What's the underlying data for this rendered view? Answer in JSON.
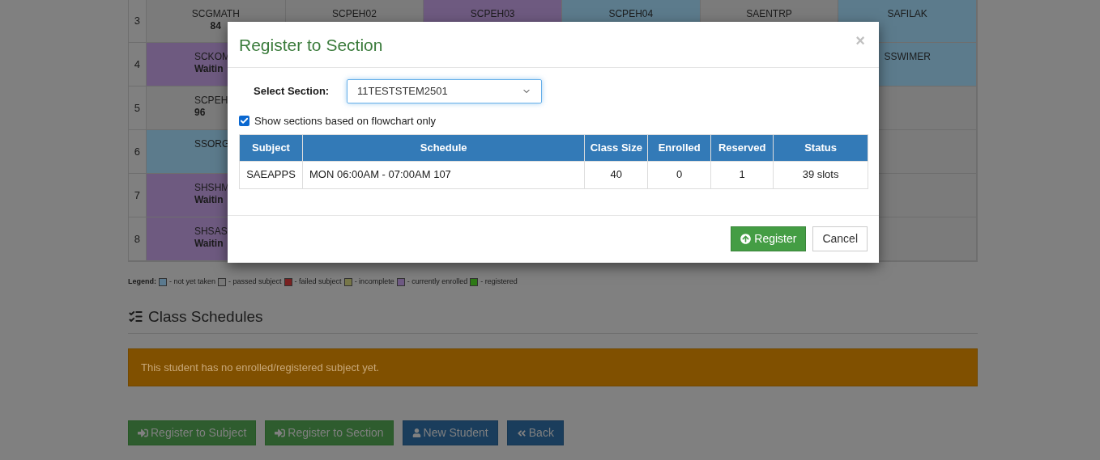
{
  "grid": {
    "rows": [
      {
        "number": "3",
        "cells": [
          {
            "code": "SCGMATH",
            "note": "84",
            "color": "#7b7b7b"
          },
          {
            "code": "SCPEH02",
            "color": "#7b7b7b"
          },
          {
            "code": "SCPEH03",
            "color": "#6e5a80"
          },
          {
            "code": "SCPEH04",
            "color": "#5c7b8c"
          },
          {
            "code": "SAENTRP",
            "color": "#7b7b7b"
          },
          {
            "code": "SAFILAK",
            "color": "#5c7b8c"
          }
        ]
      },
      {
        "number": "4",
        "cells": [
          {
            "code": "SCKOM",
            "note": "Waitin",
            "color": "#6e5a80"
          },
          null,
          null,
          null,
          null,
          {
            "code": "SSWIMER",
            "color": "#5c7b8c"
          }
        ]
      },
      {
        "number": "5",
        "cells": [
          {
            "code": "SCPEH",
            "note": "96",
            "color": "#7b7b7b"
          },
          null,
          null,
          null,
          null,
          {
            "color": "#7b7b7b"
          }
        ]
      },
      {
        "number": "6",
        "cells": [
          {
            "code": "SSORG",
            "color": "#5c7b8c"
          },
          null,
          null,
          null,
          null,
          {
            "color": "#7b7b7b"
          }
        ]
      },
      {
        "number": "7",
        "cells": [
          {
            "code": "SHSHM",
            "note": "Waitin",
            "color": "#6e5a80"
          },
          null,
          null,
          null,
          null,
          {
            "color": "#7b7b7b"
          }
        ]
      },
      {
        "number": "8",
        "cells": [
          {
            "code": "SHSAS",
            "note": "Waitin",
            "color": "#6e5a80"
          },
          null,
          null,
          null,
          null,
          {
            "color": "#7b7b7b"
          }
        ]
      }
    ]
  },
  "legend": {
    "label": "Legend:",
    "items": [
      {
        "label": "- not yet taken",
        "color": "#5b7a8f"
      },
      {
        "label": "- passed subject",
        "color": "#797979"
      },
      {
        "label": "- failed subject",
        "color": "#7a2222"
      },
      {
        "label": "- incomplete",
        "color": "#78784a"
      },
      {
        "label": "- currently enrolled",
        "color": "#6f5a84"
      },
      {
        "label": "- registered",
        "color": "#2e7a16"
      }
    ]
  },
  "class_schedules": {
    "title": "Class Schedules",
    "alert": "This student has no enrolled/registered subject yet."
  },
  "actions": [
    {
      "label": "Register to Subject",
      "kind": "register-subject"
    },
    {
      "label": "Register to Section",
      "kind": "register-section"
    },
    {
      "label": "New Student",
      "kind": "new-student"
    },
    {
      "label": "Back",
      "kind": "back"
    }
  ],
  "modal": {
    "title": "Register to Section",
    "close": "×",
    "select_label": "Select Section:",
    "select_value": "11TESTSTEM2501",
    "flowchart_only": {
      "label": "Show sections based on flowchart only",
      "checked": true
    },
    "table": {
      "columns": [
        "Subject",
        "Schedule",
        "Class Size",
        "Enrolled",
        "Reserved",
        "Status"
      ],
      "rows": [
        [
          "SAEAPPS",
          "MON 06:00AM - 07:00AM 107",
          "40",
          "0",
          "1",
          "39 slots"
        ]
      ]
    },
    "buttons": [
      {
        "label": "Register",
        "kind": "primary"
      },
      {
        "label": "Cancel",
        "kind": "default"
      }
    ]
  }
}
